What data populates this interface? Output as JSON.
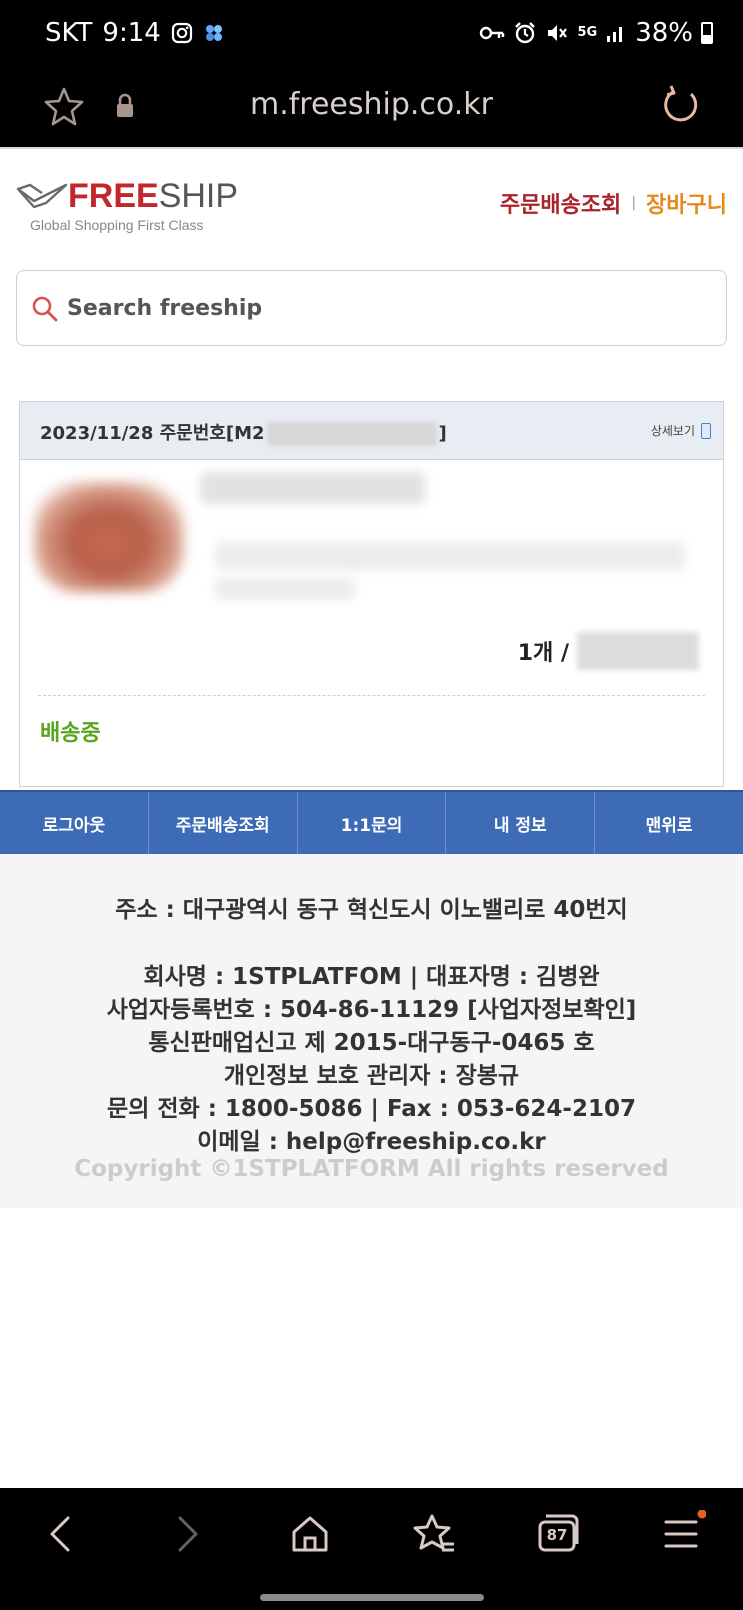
{
  "status_bar": {
    "carrier": "SKT",
    "time": "9:14",
    "network": "5G",
    "battery": "38%",
    "icons": [
      "instagram-icon",
      "app-icon",
      "key-icon",
      "alarm-icon",
      "mute-icon",
      "5g-icon",
      "signal-icon",
      "battery-icon"
    ]
  },
  "browser": {
    "url": "m.freeship.co.kr",
    "tab_count": "87"
  },
  "header": {
    "logo_free": "FREE",
    "logo_ship": "SHIP",
    "logo_tagline": "Global Shopping First Class",
    "order_lookup_link": "주문배송조회",
    "cart_link": "장바구니",
    "colors": {
      "brand_red": "#c1272d",
      "order_link": "#a8242a",
      "cart_link": "#e38a1a"
    }
  },
  "search": {
    "placeholder": "Search freeship"
  },
  "order": {
    "date_prefix": "2023/11/28 주문번호[M2",
    "date_suffix": "]",
    "detail_label": "상세보기",
    "quantity_label": "1개 /",
    "status": "배송중",
    "status_color": "#5aa51e"
  },
  "nav": {
    "items": [
      "로그아웃",
      "주문배송조회",
      "1:1문의",
      "내 정보",
      "맨위로"
    ],
    "color": "#3e6bb5"
  },
  "footer": {
    "address": "주소 : 대구광역시 동구 혁신도시 이노밸리로 40번지",
    "company": "회사명 : 1STPLATFOM | 대표자명 : 김병완",
    "business_no": "사업자등록번호 : 504-86-11129 [사업자정보확인]",
    "mail_order": "통신판매업신고 제 2015-대구동구-0465 호",
    "privacy_officer": "개인정보 보호 관리자 : 장봉규",
    "phone": "문의 전화 : 1800-5086 | Fax : 053-624-2107",
    "email": "이메일 : help@freeship.co.kr",
    "copyright": "Copyright ©1STPLATFORM All rights reserved"
  }
}
